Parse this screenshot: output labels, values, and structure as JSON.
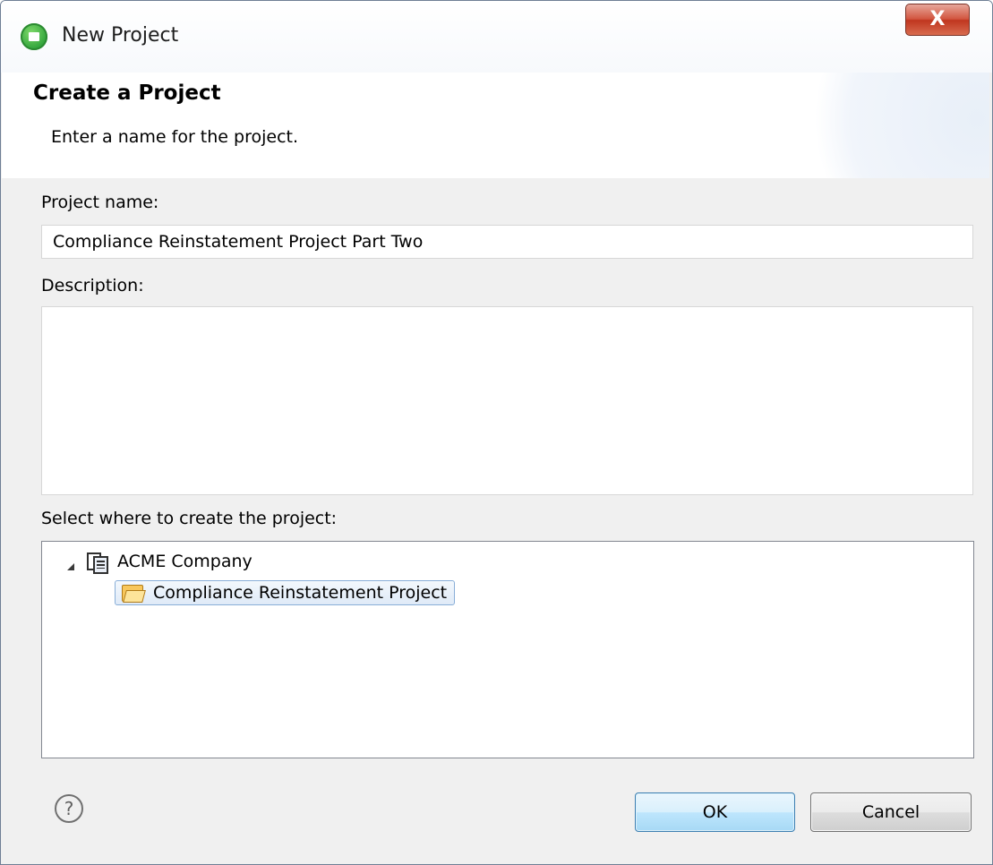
{
  "window": {
    "title": "New Project",
    "close_label": "X"
  },
  "header": {
    "title": "Create a Project",
    "description": "Enter a name for the project."
  },
  "form": {
    "project_name_label": "Project name:",
    "project_name_value": "Compliance Reinstatement Project Part Two",
    "description_label": "Description:",
    "description_value": "",
    "location_label": "Select where to create the project:"
  },
  "tree": {
    "items": [
      {
        "label": "ACME Company",
        "icon": "company-icon",
        "expanded": true
      },
      {
        "label": "Compliance Reinstatement Project",
        "icon": "folder-open-icon",
        "selected": true
      }
    ]
  },
  "footer": {
    "help_symbol": "?",
    "ok_label": "OK",
    "cancel_label": "Cancel"
  },
  "colors": {
    "close_button": "#c0361f",
    "selection_border": "#89aed8",
    "ok_border": "#3c7fb1"
  }
}
